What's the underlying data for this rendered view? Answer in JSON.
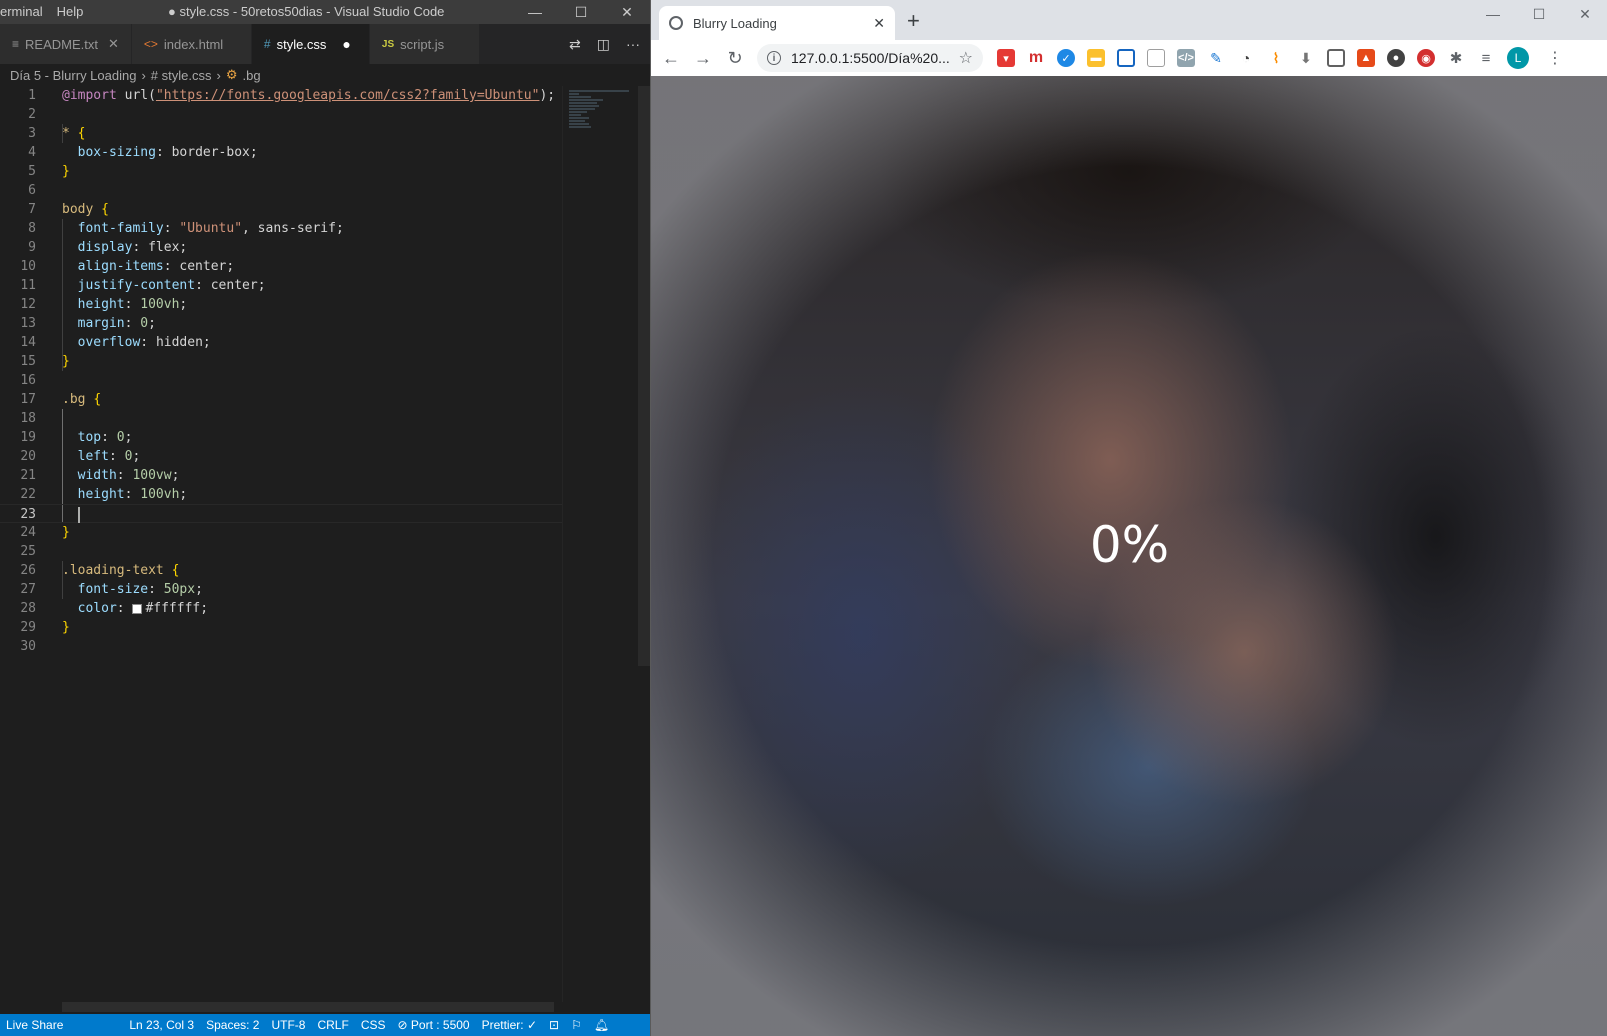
{
  "vscode": {
    "menu": [
      "erminal",
      "Help"
    ],
    "title": "● style.css - 50retos50dias - Visual Studio Code",
    "tabs": [
      {
        "icon": "≡",
        "label": "README.txt",
        "close": "✕"
      },
      {
        "icon": "<>",
        "label": "index.html"
      },
      {
        "icon": "#",
        "label": "style.css",
        "dot": "●"
      },
      {
        "icon": "JS",
        "label": "script.js"
      }
    ],
    "breadcrumb": [
      "Día 5 - Blurry Loading",
      "# style.css",
      ".bg"
    ],
    "code": [
      "@import url(\"https://fonts.googleapis.com/css2?family=Ubuntu\");",
      "",
      "* {",
      "  box-sizing: border-box;",
      "}",
      "",
      "body {",
      "  font-family: \"Ubuntu\", sans-serif;",
      "  display: flex;",
      "  align-items: center;",
      "  justify-content: center;",
      "  height: 100vh;",
      "  margin: 0;",
      "  overflow: hidden;",
      "}",
      "",
      ".bg {",
      "",
      "  top: 0;",
      "  left: 0;",
      "  width: 100vw;",
      "  height: 100vh;",
      "  ",
      "}",
      "",
      ".loading-text {",
      "  font-size: 50px;",
      "  color: #ffffff;",
      "}",
      ""
    ],
    "status": {
      "live_share": "Live Share",
      "position": "Ln 23, Col 3",
      "spaces": "Spaces: 2",
      "encoding": "UTF-8",
      "eol": "CRLF",
      "language": "CSS",
      "port": "⊘ Port : 5500",
      "prettier": "Prettier: ✓"
    }
  },
  "chrome": {
    "tab_title": "Blurry Loading",
    "tab_close": "✕",
    "new_tab": "+",
    "url": "127.0.0.1:5500/Día%20...",
    "avatar_letter": "L",
    "loading_text": "0%"
  },
  "colors": {
    "vscode_bg": "#1e1e1e",
    "statusbar": "#007acc",
    "selector": "#d7ba7d",
    "property": "#9cdcfe",
    "string": "#ce9178",
    "number": "#b5cea8"
  },
  "icons": [
    "close-icon",
    "source-control-icon",
    "split-editor-icon",
    "more-icon",
    "back-icon",
    "forward-icon",
    "reload-icon",
    "info-icon",
    "star-icon",
    "extensions-icon",
    "menu-icon"
  ]
}
